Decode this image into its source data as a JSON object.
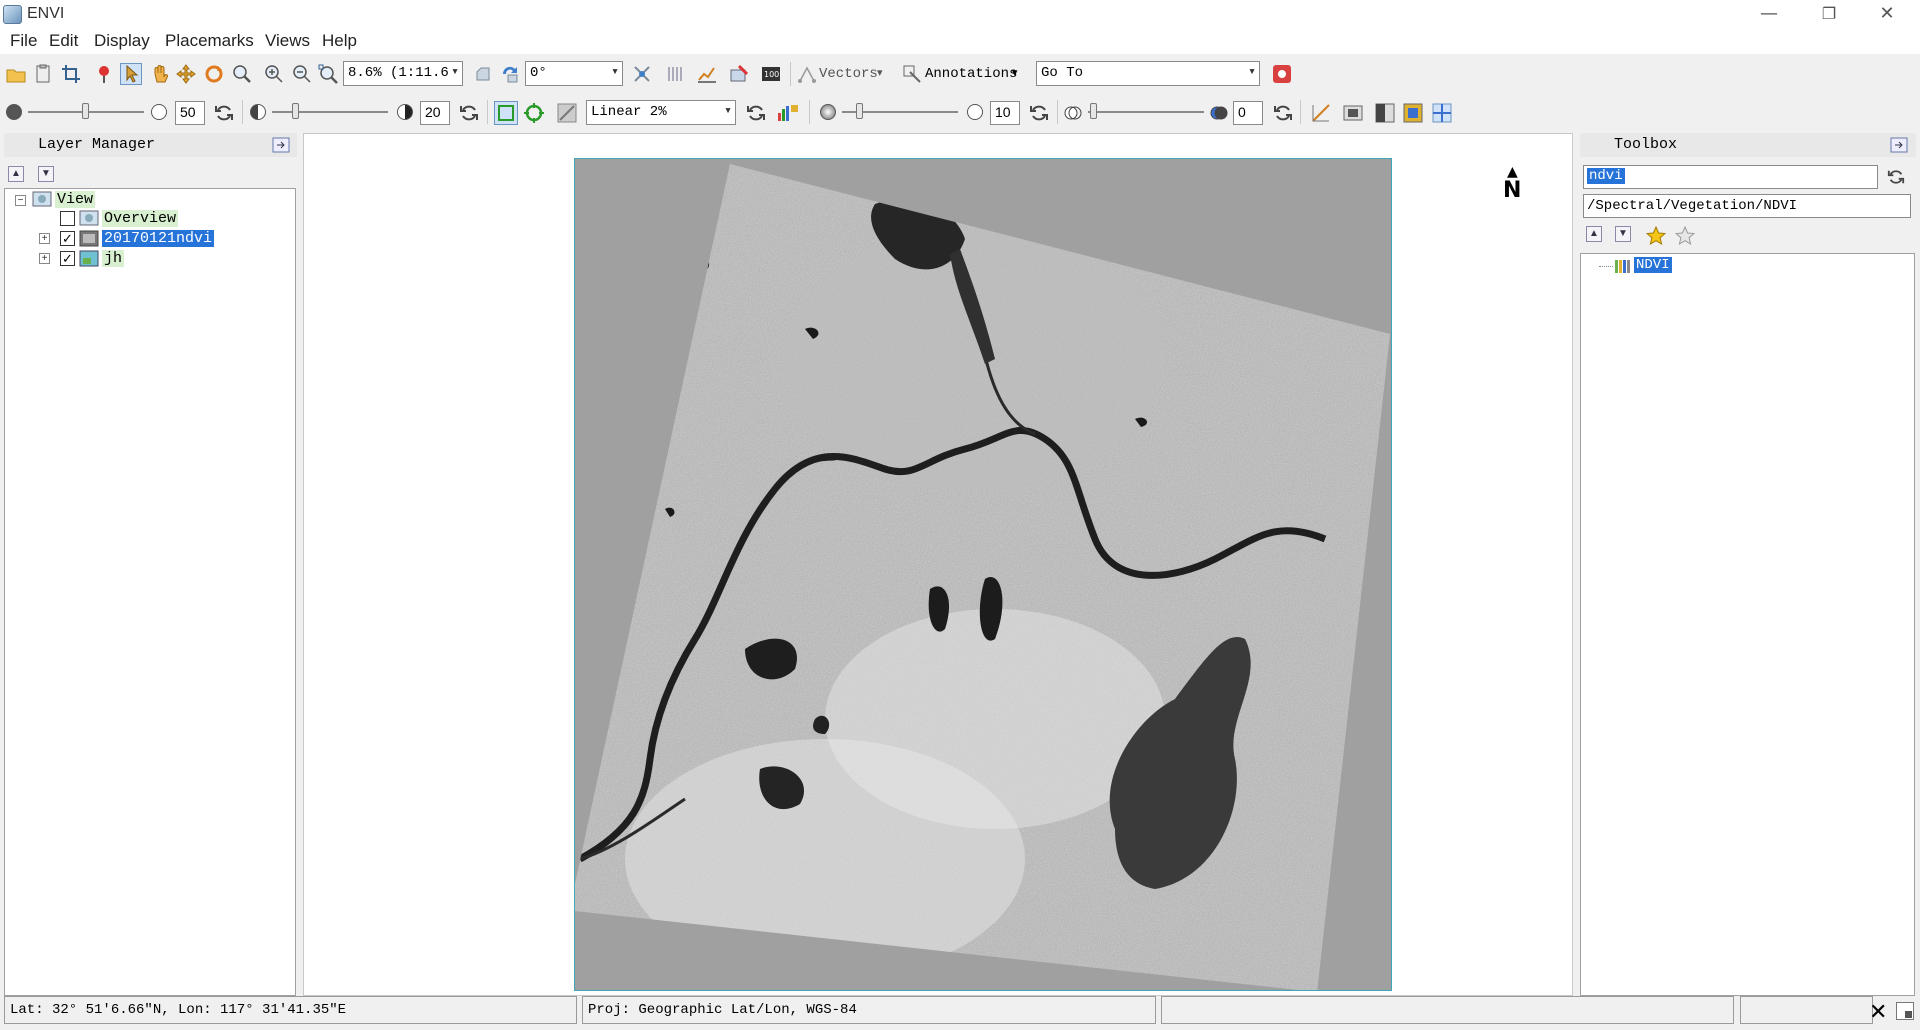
{
  "window": {
    "title": "ENVI",
    "minimize": "—",
    "restore": "❐",
    "close": "✕"
  },
  "menu": [
    "File",
    "Edit",
    "Display",
    "Placemarks",
    "Views",
    "Help"
  ],
  "toolbar1": {
    "zoom_value": "8.6% (1:11.6",
    "rotation_value": "0°",
    "vectors_label": "Vectors",
    "annotations_label": "Annotations",
    "goto_value": "Go To"
  },
  "toolbar2": {
    "brightness_value": "50",
    "contrast_value": "20",
    "stretch_value": "Linear 2%",
    "sharpen_value": "10",
    "transparency_value": "0"
  },
  "layer_manager": {
    "title": "Layer Manager",
    "tree": {
      "root": "View",
      "items": [
        {
          "label": "Overview",
          "checked": false
        },
        {
          "label": "20170121ndvi",
          "checked": true
        },
        {
          "label": "jh",
          "checked": true
        }
      ]
    }
  },
  "view": {
    "north_label": "N"
  },
  "toolbox": {
    "title": "Toolbox",
    "search_value": "ndvi",
    "path": "/Spectral/Vegetation/NDVI",
    "result": "NDVI"
  },
  "status": {
    "coords": "Lat: 32° 51′6.66″N, Lon: 117° 31′41.35″E",
    "projection": "Proj: Geographic Lat/Lon, WGS-84",
    "message": "",
    "extra": ""
  },
  "colors": {
    "selection": "#2673d9",
    "map_background": "#a0a0a0",
    "view_border": "#3fa8b8"
  }
}
